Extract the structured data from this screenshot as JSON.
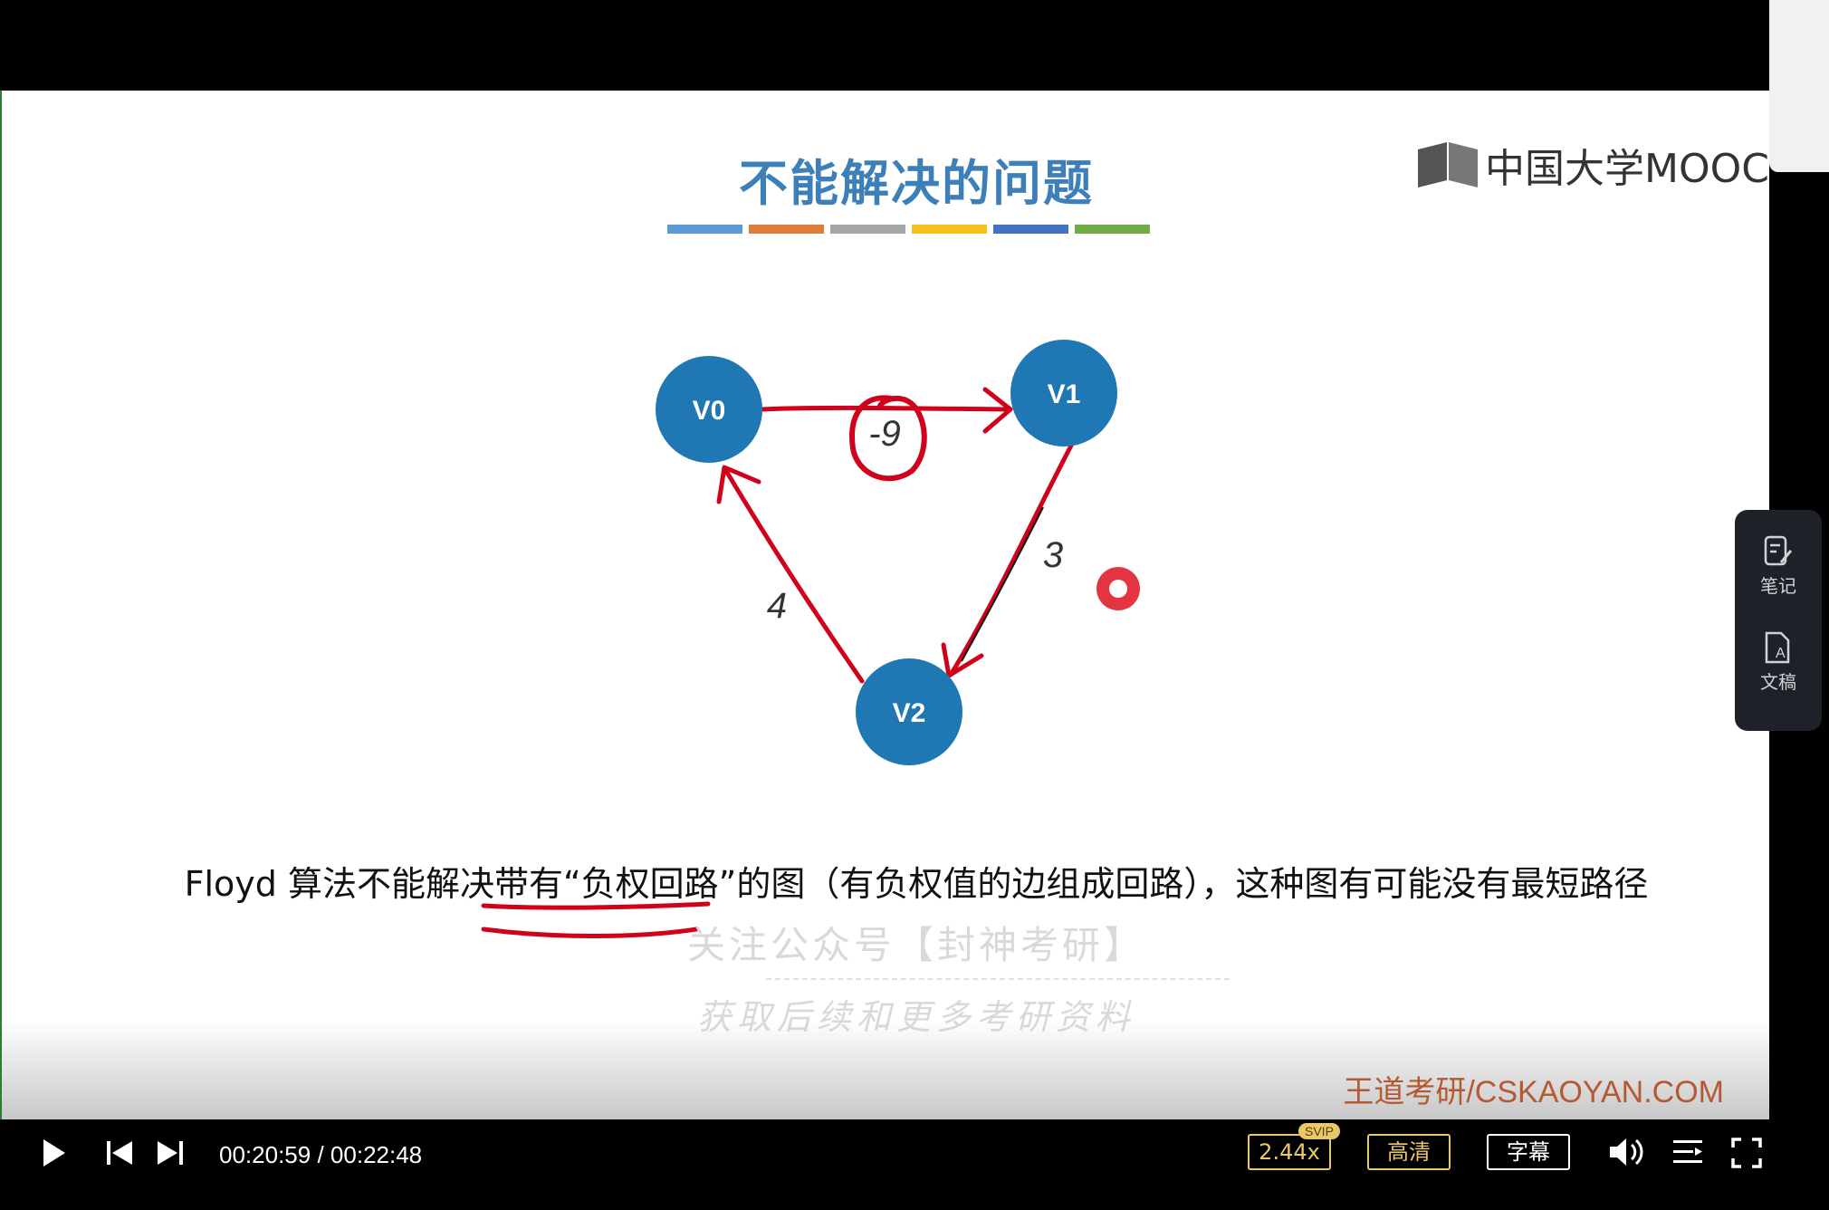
{
  "slide": {
    "title": "不能解决的问题",
    "logo_text": "中国大学MOOC",
    "bar_colors": [
      "#5b9bd5",
      "#e07b39",
      "#a5a5a5",
      "#f2c21b",
      "#4472c4",
      "#70ad47"
    ],
    "nodes": {
      "v0": "V0",
      "v1": "V1",
      "v2": "V2"
    },
    "weights": {
      "v0_v1": "-9",
      "v1_v2": "3",
      "v2_v0": "4"
    },
    "caption": "Floyd 算法不能解决带有“负权回路”的图（有负权值的边组成回路），这种图有可能没有最短路径",
    "watermark_line1": "关注公众号【封神考研】",
    "watermark_line2": "获取后续和更多考研资料",
    "site_text": "王道考研/CSKAOYAN.COM",
    "node_color": "#1f78b4",
    "annotation_color": "#d0021b"
  },
  "side_panel": {
    "notes_label": "笔记",
    "doc_label": "文稿"
  },
  "player": {
    "current_time": "00:20:59",
    "separator": "/",
    "total_time": "00:22:48",
    "progress": 0.92,
    "speed": "2.44x",
    "speed_badge": "SVIP",
    "quality": "高清",
    "subtitle": "字幕",
    "icons": [
      "play-icon",
      "previous-icon",
      "next-icon",
      "volume-icon",
      "playlist-icon",
      "fullscreen-icon"
    ]
  }
}
